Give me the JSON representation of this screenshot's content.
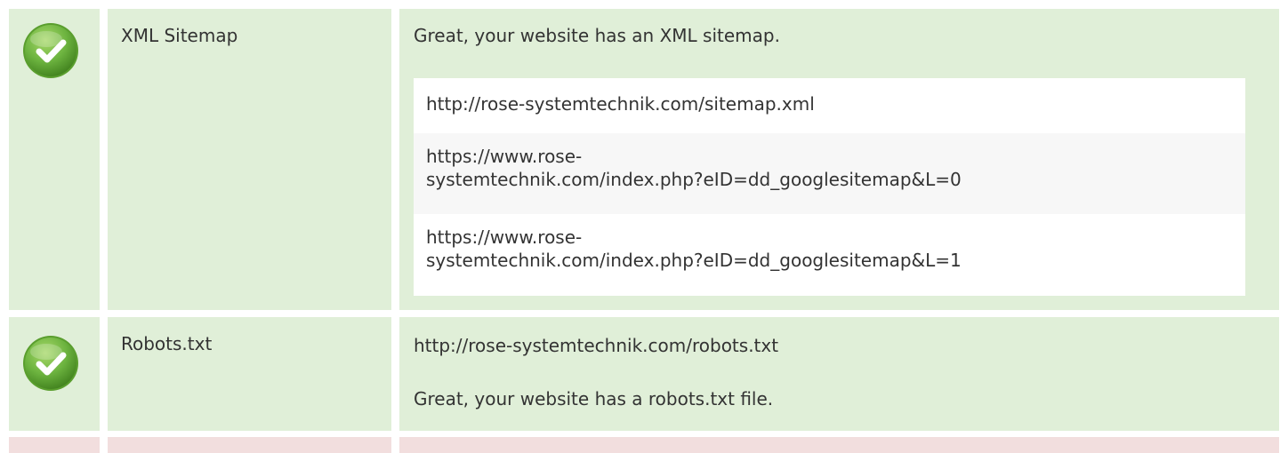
{
  "rows": [
    {
      "status": "pass",
      "icon": "check-circle-icon",
      "label": "XML Sitemap",
      "message": "Great, your website has an XML sitemap.",
      "urls": [
        "http://rose-systemtechnik.com/sitemap.xml",
        "https://www.rose-\nsystemtechnik.com/index.php?eID=dd_googlesitemap&L=0",
        "https://www.rose-\nsystemtechnik.com/index.php?eID=dd_googlesitemap&L=1"
      ]
    },
    {
      "status": "pass",
      "icon": "check-circle-icon",
      "label": "Robots.txt",
      "url": "http://rose-systemtechnik.com/robots.txt",
      "message": "Great, your website has a robots.txt file."
    },
    {
      "status": "fail"
    }
  ],
  "colors": {
    "pass_bg": "#e0efd8",
    "fail_bg": "#f2dede",
    "check_green": "#6cb33f",
    "text": "#333333"
  }
}
